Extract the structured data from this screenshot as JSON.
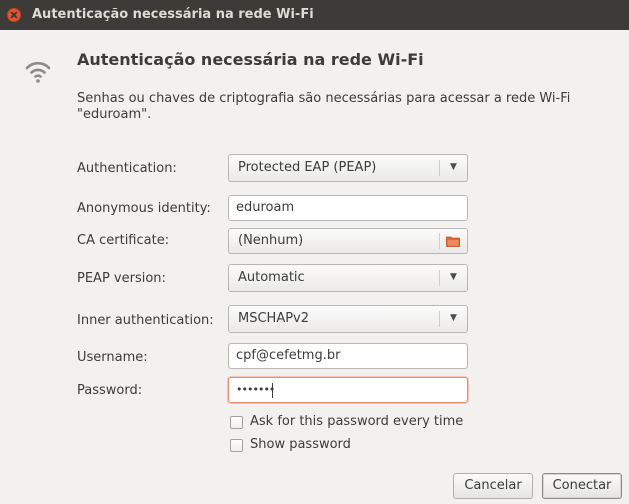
{
  "window": {
    "title": "Autenticação necessária na rede Wi-Fi"
  },
  "dialog": {
    "icon": "wifi-icon",
    "heading": "Autenticação necessária na rede Wi-Fi",
    "description": "Senhas ou chaves de criptografia são necessárias para acessar a rede Wi-Fi \"eduroam\"."
  },
  "form": {
    "authentication": {
      "label": "Authentication:",
      "value": "Protected EAP (PEAP)"
    },
    "anonymous_identity": {
      "label": "Anonymous identity:",
      "value": "eduroam"
    },
    "ca_certificate": {
      "label": "CA certificate:",
      "value": "(Nenhum)",
      "icon": "folder-icon"
    },
    "peap_version": {
      "label": "PEAP version:",
      "value": "Automatic"
    },
    "inner_authentication": {
      "label": "Inner authentication:",
      "value": "MSCHAPv2"
    },
    "username": {
      "label": "Username:",
      "value": "cpf@cefetmg.br"
    },
    "password": {
      "label": "Password:",
      "value": "•••••••"
    },
    "ask_password": {
      "label": "Ask for this password every time",
      "checked": false
    },
    "show_password": {
      "label": "Show password",
      "checked": false
    }
  },
  "buttons": {
    "cancel": "Cancelar",
    "connect": "Conectar"
  },
  "colors": {
    "titlebar": "#3c3b37",
    "close_button": "#e9542f",
    "focus_border": "#e98c6c",
    "folder_icon": "#e5693e"
  }
}
